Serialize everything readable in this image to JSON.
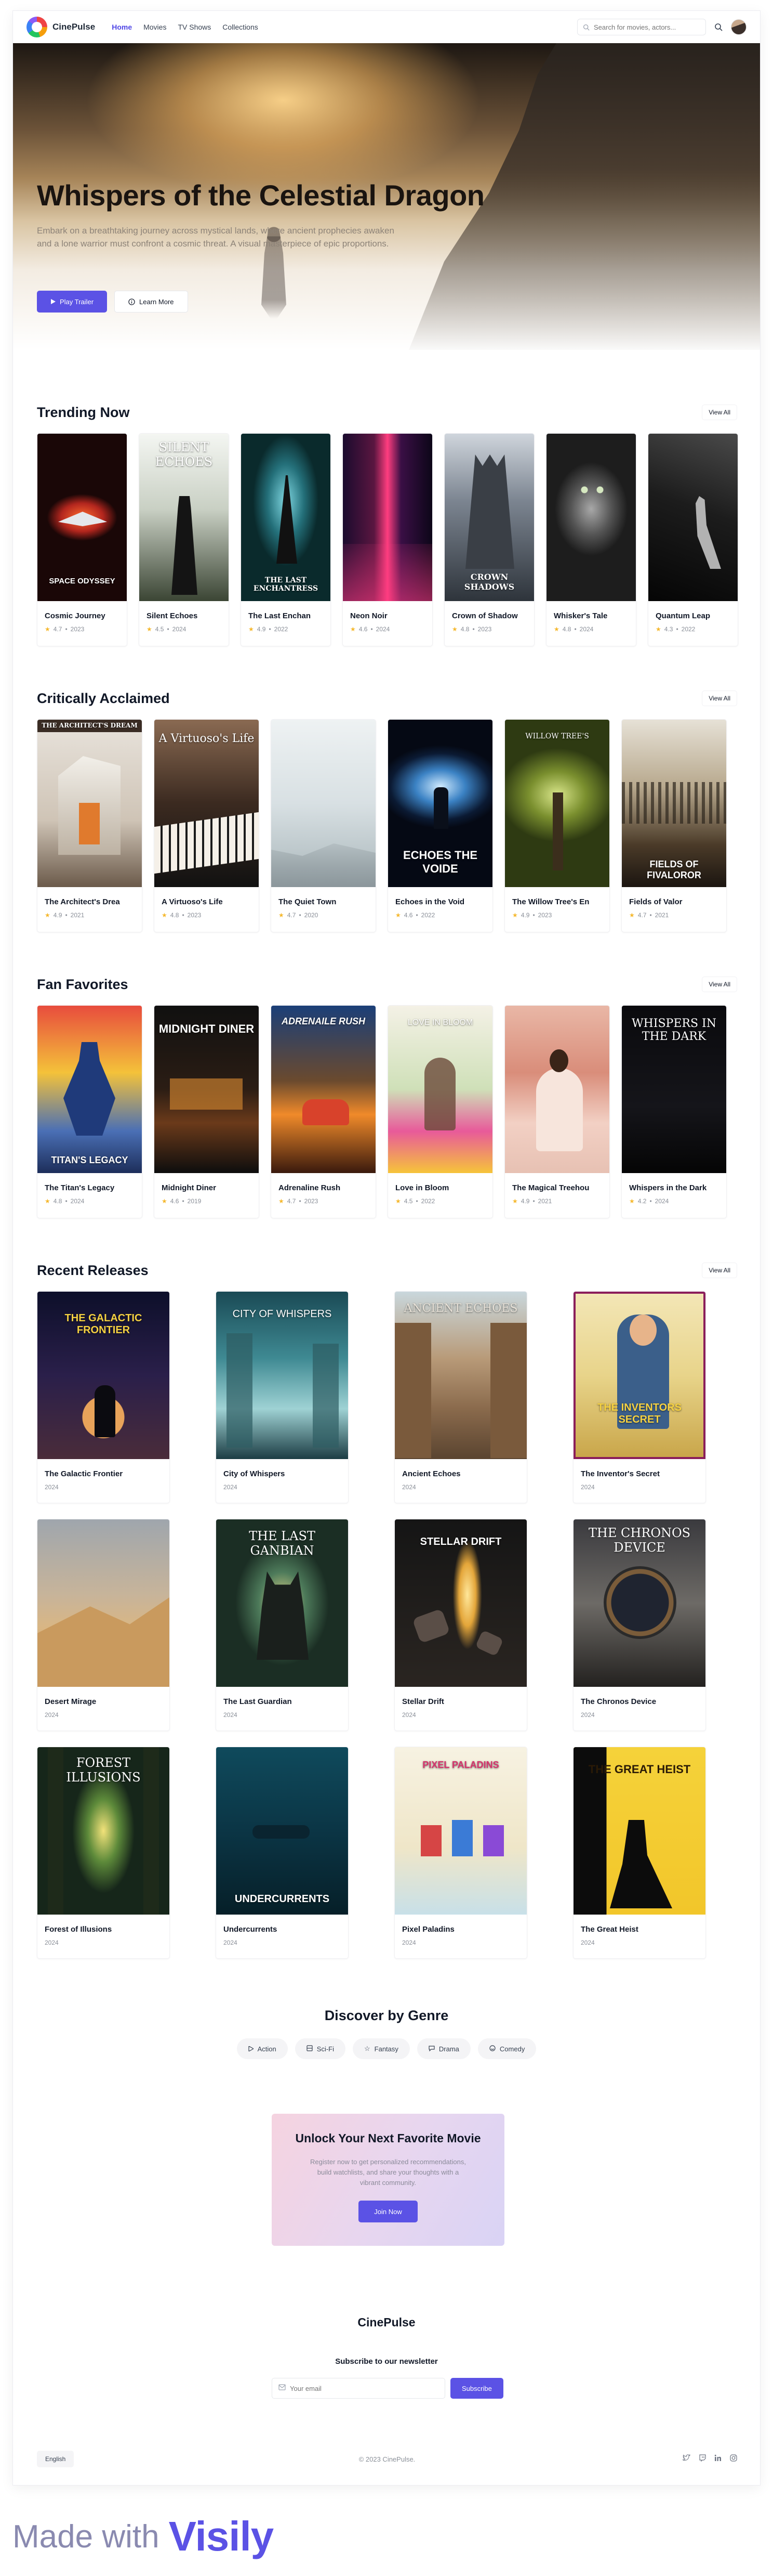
{
  "brand": {
    "name": "CinePulse",
    "accent": "#5b52e5"
  },
  "nav": {
    "links": [
      {
        "label": "Home",
        "active": true
      },
      {
        "label": "Movies"
      },
      {
        "label": "TV Shows"
      },
      {
        "label": "Collections"
      }
    ],
    "search_placeholder": "Search for movies, actors..."
  },
  "hero": {
    "title": "Whispers of the Celestial Dragon",
    "description": "Embark on a breathtaking journey across mystical lands, where ancient prophecies awaken and a lone warrior must confront a cosmic threat. A visual masterpiece of epic proportions.",
    "primary_button": "Play Trailer",
    "secondary_button": "Learn More"
  },
  "trending": {
    "title": "Trending Now",
    "view_all": "View All",
    "items": [
      {
        "title": "Cosmic Journey",
        "rating": "4.7",
        "year": "2023",
        "poster_text": "SPACE ODYSSEY"
      },
      {
        "title": "Silent Echoes",
        "rating": "4.5",
        "year": "2024",
        "poster_text": "SILENT ECHOES"
      },
      {
        "title": "The Last Enchan",
        "rating": "4.9",
        "year": "2022",
        "poster_text": "THE LAST ENCHANTRESS"
      },
      {
        "title": "Neon Noir",
        "rating": "4.6",
        "year": "2024",
        "poster_text": ""
      },
      {
        "title": "Crown of Shadow",
        "rating": "4.8",
        "year": "2023",
        "poster_text": "CROWN SHADOWS"
      },
      {
        "title": "Whisker's Tale",
        "rating": "4.8",
        "year": "2024",
        "poster_text": ""
      },
      {
        "title": "Quantum Leap",
        "rating": "4.3",
        "year": "2022",
        "poster_text": ""
      }
    ]
  },
  "acclaimed": {
    "title": "Critically Acclaimed",
    "view_all": "View All",
    "items": [
      {
        "title": "The Architect's Drea",
        "rating": "4.9",
        "year": "2021",
        "poster_text": "THE ARCHITECT'S DREAM"
      },
      {
        "title": "A Virtuoso's Life",
        "rating": "4.8",
        "year": "2023",
        "poster_text": "A Virtuoso's Life"
      },
      {
        "title": "The Quiet Town",
        "rating": "4.7",
        "year": "2020",
        "poster_text": ""
      },
      {
        "title": "Echoes in the Void",
        "rating": "4.6",
        "year": "2022",
        "poster_text": "ECHOES THE VOIDE"
      },
      {
        "title": "The Willow Tree's En",
        "rating": "4.9",
        "year": "2023",
        "poster_text": "WILLOW TREE'S"
      },
      {
        "title": "Fields of Valor",
        "rating": "4.7",
        "year": "2021",
        "poster_text": "FIELDS OF FIVALOROR"
      }
    ]
  },
  "favorites": {
    "title": "Fan Favorites",
    "view_all": "View All",
    "items": [
      {
        "title": "The Titan's Legacy",
        "rating": "4.8",
        "year": "2024",
        "poster_text": "TITAN'S LEGACY"
      },
      {
        "title": "Midnight Diner",
        "rating": "4.6",
        "year": "2019",
        "poster_text": "MIDNIGHT DINER"
      },
      {
        "title": "Adrenaline Rush",
        "rating": "4.7",
        "year": "2023",
        "poster_text": "ADRENAILE RUSH"
      },
      {
        "title": "Love in Bloom",
        "rating": "4.5",
        "year": "2022",
        "poster_text": "LOVE IN BLOOM"
      },
      {
        "title": "The Magical Treehou",
        "rating": "4.9",
        "year": "2021",
        "poster_text": ""
      },
      {
        "title": "Whispers in the Dark",
        "rating": "4.2",
        "year": "2024",
        "poster_text": "WHISPERS IN THE DARK"
      }
    ]
  },
  "recent": {
    "title": "Recent Releases",
    "view_all": "View All",
    "items": [
      {
        "title": "The Galactic Frontier",
        "year": "2024",
        "poster_text": "THE GALACTIC FRONTIER"
      },
      {
        "title": "City of Whispers",
        "year": "2024",
        "poster_text": "CITY OF WHISPERS"
      },
      {
        "title": "Ancient Echoes",
        "year": "2024",
        "poster_text": "ANCIENT ECHOES"
      },
      {
        "title": "The Inventor's Secret",
        "year": "2024",
        "poster_text": "THE INVENTORS SECRET"
      },
      {
        "title": "Desert Mirage",
        "year": "2024",
        "poster_text": ""
      },
      {
        "title": "The Last Guardian",
        "year": "2024",
        "poster_text": "THE LAST GANBIAN"
      },
      {
        "title": "Stellar Drift",
        "year": "2024",
        "poster_text": "STELLAR DRIFT"
      },
      {
        "title": "The Chronos Device",
        "year": "2024",
        "poster_text": "THE CHRONOS DEVICE"
      },
      {
        "title": "Forest of Illusions",
        "year": "2024",
        "poster_text": "FOREST ILLUSIONS"
      },
      {
        "title": "Undercurrents",
        "year": "2024",
        "poster_text": "UNDERCURRENTS"
      },
      {
        "title": "Pixel Paladins",
        "year": "2024",
        "poster_text": "PIXEL PALADINS"
      },
      {
        "title": "The Great Heist",
        "year": "2024",
        "poster_text": "THE GREAT HEIST"
      }
    ]
  },
  "genres": {
    "title": "Discover by Genre",
    "items": [
      {
        "label": "Action",
        "icon": "play-icon"
      },
      {
        "label": "Sci-Fi",
        "icon": "film-icon"
      },
      {
        "label": "Fantasy",
        "icon": "star-icon"
      },
      {
        "label": "Drama",
        "icon": "chat-icon"
      },
      {
        "label": "Comedy",
        "icon": "smile-icon"
      }
    ]
  },
  "cta": {
    "title": "Unlock Your Next Favorite Movie",
    "description": "Register now to get personalized recommendations, build watchlists, and share your thoughts with a vibrant community.",
    "button": "Join Now"
  },
  "footer": {
    "brand": "CinePulse",
    "newsletter_title": "Subscribe to our newsletter",
    "email_placeholder": "Your email",
    "subscribe": "Subscribe",
    "language": "English",
    "copyright": "© 2023 CinePulse.",
    "socials": [
      "twitter-icon",
      "twitch-icon",
      "linkedin-icon",
      "instagram-icon"
    ]
  },
  "watermark": {
    "prefix": "Made with",
    "brand": "Visily"
  }
}
